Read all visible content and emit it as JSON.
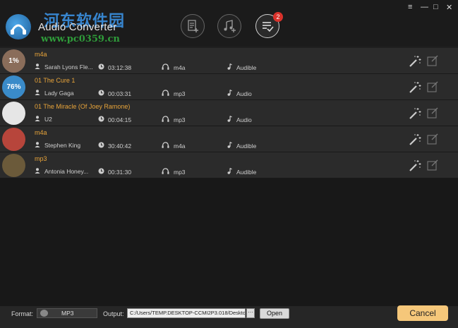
{
  "app": {
    "title": "Audio Converter",
    "watermark_cn": "河东软件园",
    "watermark_url": "www.pc0359.cn"
  },
  "toolbar": {
    "add_files_icon": "add-file-icon",
    "add_music_icon": "add-music-icon",
    "list_icon": "converted-list-icon",
    "badge_count": "2"
  },
  "window_controls": {
    "menu": "≡",
    "minimize": "—",
    "maximize": "□",
    "close": "✕"
  },
  "rows": [
    {
      "title": "m4a",
      "artist": "Sarah Lyons Fle...",
      "duration": "03:12:38",
      "format": "m4a",
      "genre": "Audible",
      "progress_label": "1%",
      "thumb_color": "#8a6d5a"
    },
    {
      "title": "01 The Cure 1",
      "artist": "Lady Gaga",
      "duration": "00:03:31",
      "format": "mp3",
      "genre": "Audio",
      "progress_label": "76%",
      "thumb_color": "#3a8bc9"
    },
    {
      "title": "01 The Miracle (Of Joey Ramone)",
      "artist": "U2",
      "duration": "00:04:15",
      "format": "mp3",
      "genre": "Audio",
      "progress_label": "",
      "thumb_color": "#e6e6e6"
    },
    {
      "title": "m4a",
      "artist": "Stephen King",
      "duration": "30:40:42",
      "format": "m4a",
      "genre": "Audible",
      "progress_label": "",
      "thumb_color": "#b7453b"
    },
    {
      "title": "mp3",
      "artist": "Antonia Honey...",
      "duration": "00:31:30",
      "format": "mp3",
      "genre": "Audible",
      "progress_label": "",
      "thumb_color": "#6b5a3a"
    }
  ],
  "footer": {
    "format_label": "Format:",
    "format_value": "MP3",
    "output_label": "Output:",
    "output_path": "C:/Users/TEMP.DESKTOP-CCMI2P3.018/Deskto",
    "browse_label": "···",
    "open_label": "Open",
    "cancel_label": "Cancel"
  }
}
